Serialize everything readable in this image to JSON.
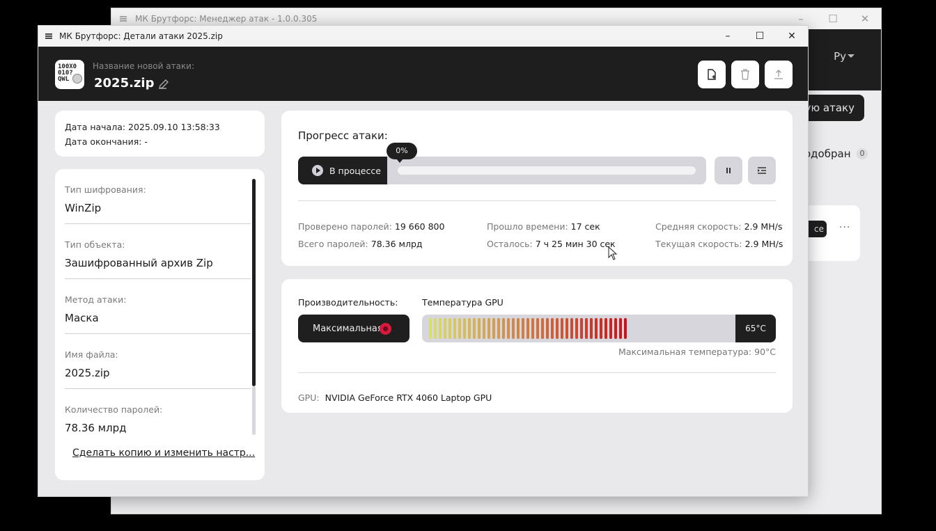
{
  "background_window": {
    "title": "МК Брутфорс: Менеджер атак - 1.0.0.305",
    "controls": [
      "–",
      "☐",
      "✕"
    ],
    "language": "Ру",
    "new_attack_button": "ую атаку",
    "found_label": "одобран",
    "found_count": "0",
    "card_chip": "се",
    "card_menu": "···"
  },
  "window": {
    "title": "МК Брутфорс: Детали атаки 2025.zip",
    "controls": [
      "–",
      "☐",
      "✕"
    ]
  },
  "header": {
    "logo_text": [
      "100X0",
      "010?",
      "QWL"
    ],
    "name_label": "Название новой атаки:",
    "name_value": "2025.zip",
    "icons": [
      "new-file-icon",
      "trash-icon",
      "upload-icon"
    ]
  },
  "dates": {
    "start": "Дата начала: 2025.09.10 13:58:33",
    "end": "Дата окончания: -"
  },
  "details": [
    {
      "label": "Тип шифрования:",
      "value": "WinZip"
    },
    {
      "label": "Тип объекта:",
      "value": "Зашифрованный архив Zip"
    },
    {
      "label": "Метод атаки:",
      "value": "Маска"
    },
    {
      "label": "Имя файла:",
      "value": "2025.zip"
    },
    {
      "label": "Количество паролей:",
      "value": "78.36 млрд"
    }
  ],
  "copy_link": "Сделать копию и изменить настр...",
  "progress": {
    "title": "Прогресс атаки:",
    "state": "В процессе",
    "percent_label": "0%",
    "percent": 0,
    "pause_icon": "pause-icon",
    "log_icon": "list-icon"
  },
  "stats": {
    "checked_label": "Проверено паролей:",
    "checked_value": "19 660 800",
    "total_label": "Всего паролей:",
    "total_value": "78.36 млрд",
    "elapsed_label": "Прошло времени:",
    "elapsed_value": "17 сек",
    "remaining_label": "Осталось:",
    "remaining_value": "7 ч 25 мин 30 сек",
    "avg_speed_label": "Средняя скорость:",
    "avg_speed_value": "2.9 MH/s",
    "cur_speed_label": "Текущая скорость:",
    "cur_speed_value": "2.9 MH/s"
  },
  "performance": {
    "label": "Производительность:",
    "mode": "Максимальная",
    "gpu_temp_label": "Температура GPU",
    "gpu_temp_value": "65°C",
    "gpu_temp_fraction": 0.72,
    "max_temp": "Максимальная температура: 90°C",
    "gpu_label": "GPU:",
    "gpu_name": "NVIDIA GeForce RTX 4060 Laptop GPU"
  },
  "colors": {
    "dark": "#1f1f1f",
    "accent_red": "#d61a3c",
    "gradient_start": "#d8e06a",
    "gradient_end": "#c8141c"
  }
}
